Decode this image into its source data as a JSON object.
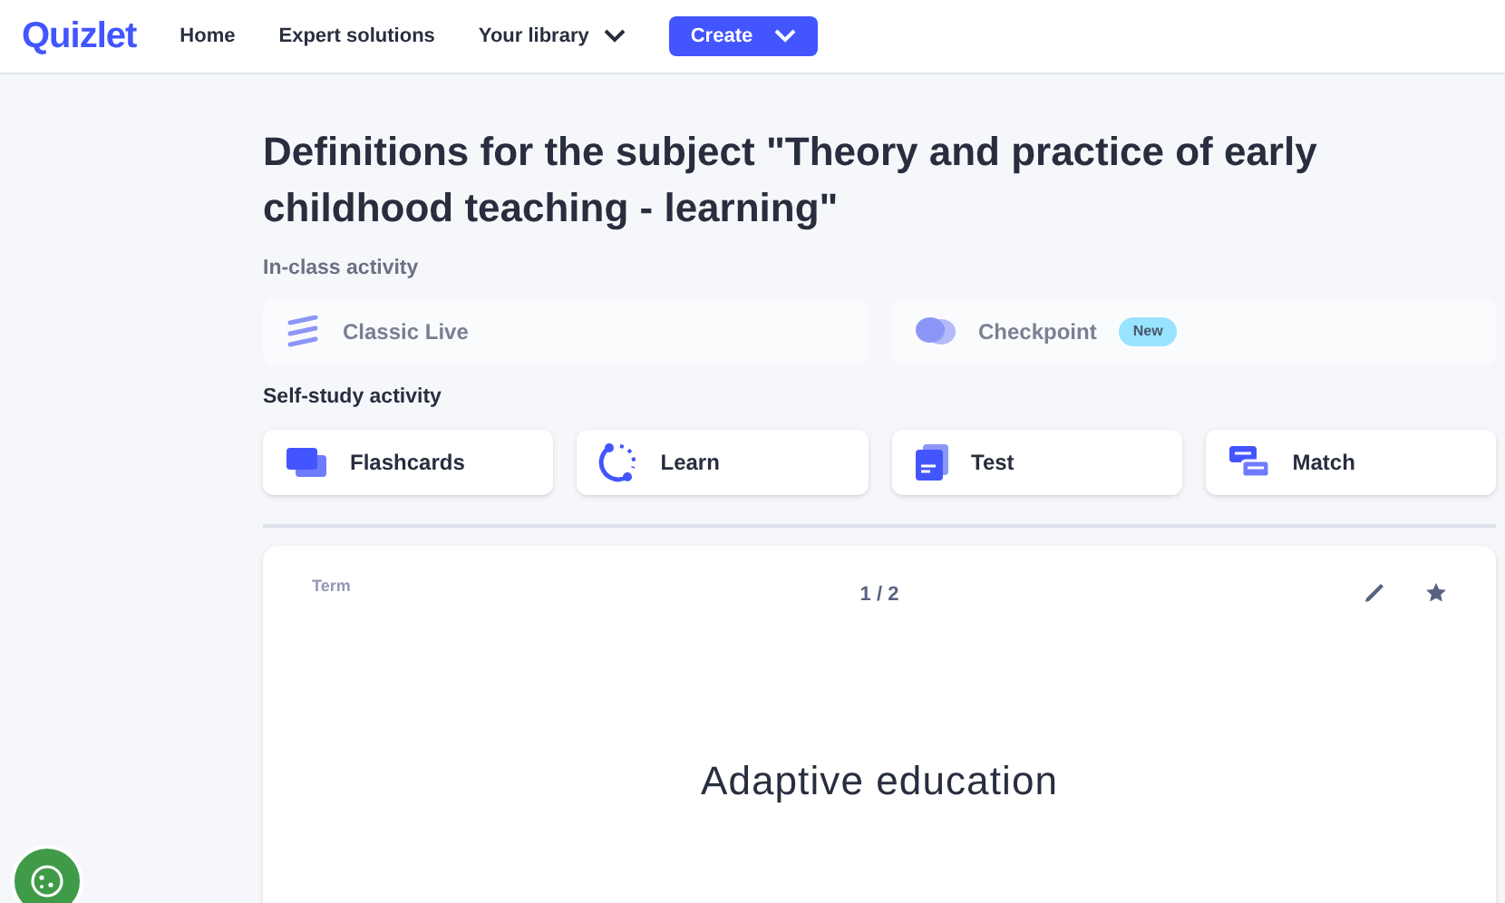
{
  "nav": {
    "logo": "Quizlet",
    "links": [
      "Home",
      "Expert solutions"
    ],
    "library": "Your library",
    "create": "Create"
  },
  "title": "Definitions for the subject \"Theory and practice of early childhood teaching - learning\"",
  "sections": [
    {
      "heading": "In-class activity",
      "muted": true,
      "activities": [
        {
          "kind": "live",
          "label": "Classic Live"
        },
        {
          "kind": "checkpoint",
          "label": "Checkpoint",
          "badge": "New"
        }
      ]
    },
    {
      "heading": "Self-study activity",
      "muted": false,
      "activities": [
        {
          "kind": "flashcards",
          "label": "Flashcards"
        },
        {
          "kind": "learn",
          "label": "Learn"
        },
        {
          "kind": "test",
          "label": "Test"
        },
        {
          "kind": "match",
          "label": "Match"
        }
      ]
    }
  ],
  "card": {
    "side": "Term",
    "counter": "1 / 2",
    "text": "Adaptive education"
  }
}
